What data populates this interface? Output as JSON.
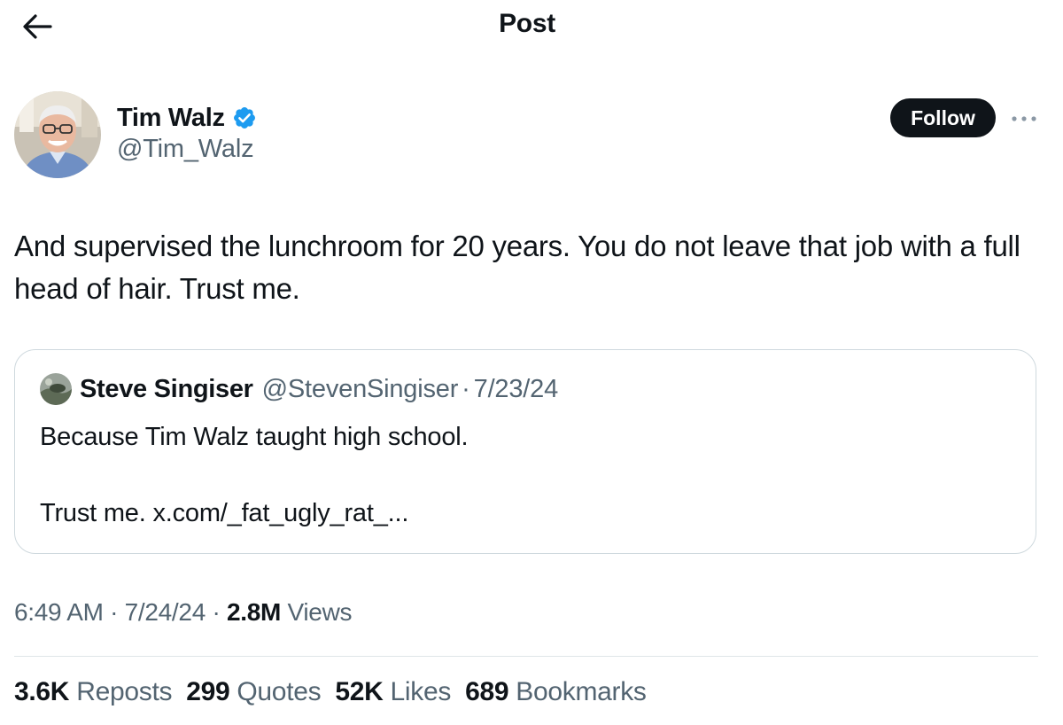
{
  "header": {
    "title": "Post"
  },
  "author": {
    "name": "Tim Walz",
    "handle": "@Tim_Walz",
    "verified": true
  },
  "actions": {
    "follow_label": "Follow"
  },
  "post": {
    "text": "And supervised the lunchroom for 20 years. You do not leave that job with a full head of hair. Trust me."
  },
  "quote": {
    "name": "Steve Singiser",
    "handle": "@StevenSingiser",
    "separator": "·",
    "date": "7/23/24",
    "line1": "Because Tim Walz taught high school.",
    "line2": "Trust me. x.com/_fat_ugly_rat_..."
  },
  "meta": {
    "time": "6:49 AM",
    "separator": "·",
    "date": "7/24/24",
    "views_count": "2.8M",
    "views_label": "Views"
  },
  "stats": [
    {
      "count": "3.6K",
      "label": "Reposts"
    },
    {
      "count": "299",
      "label": "Quotes"
    },
    {
      "count": "52K",
      "label": "Likes"
    },
    {
      "count": "689",
      "label": "Bookmarks"
    }
  ],
  "colors": {
    "text_primary": "#0f1419",
    "text_secondary": "#536471",
    "verified_blue": "#1d9bf0",
    "border": "#cfd9de"
  },
  "icons": {
    "back": "arrow-left-icon",
    "verified": "verified-badge-icon",
    "more": "more-horizontal-icon"
  }
}
